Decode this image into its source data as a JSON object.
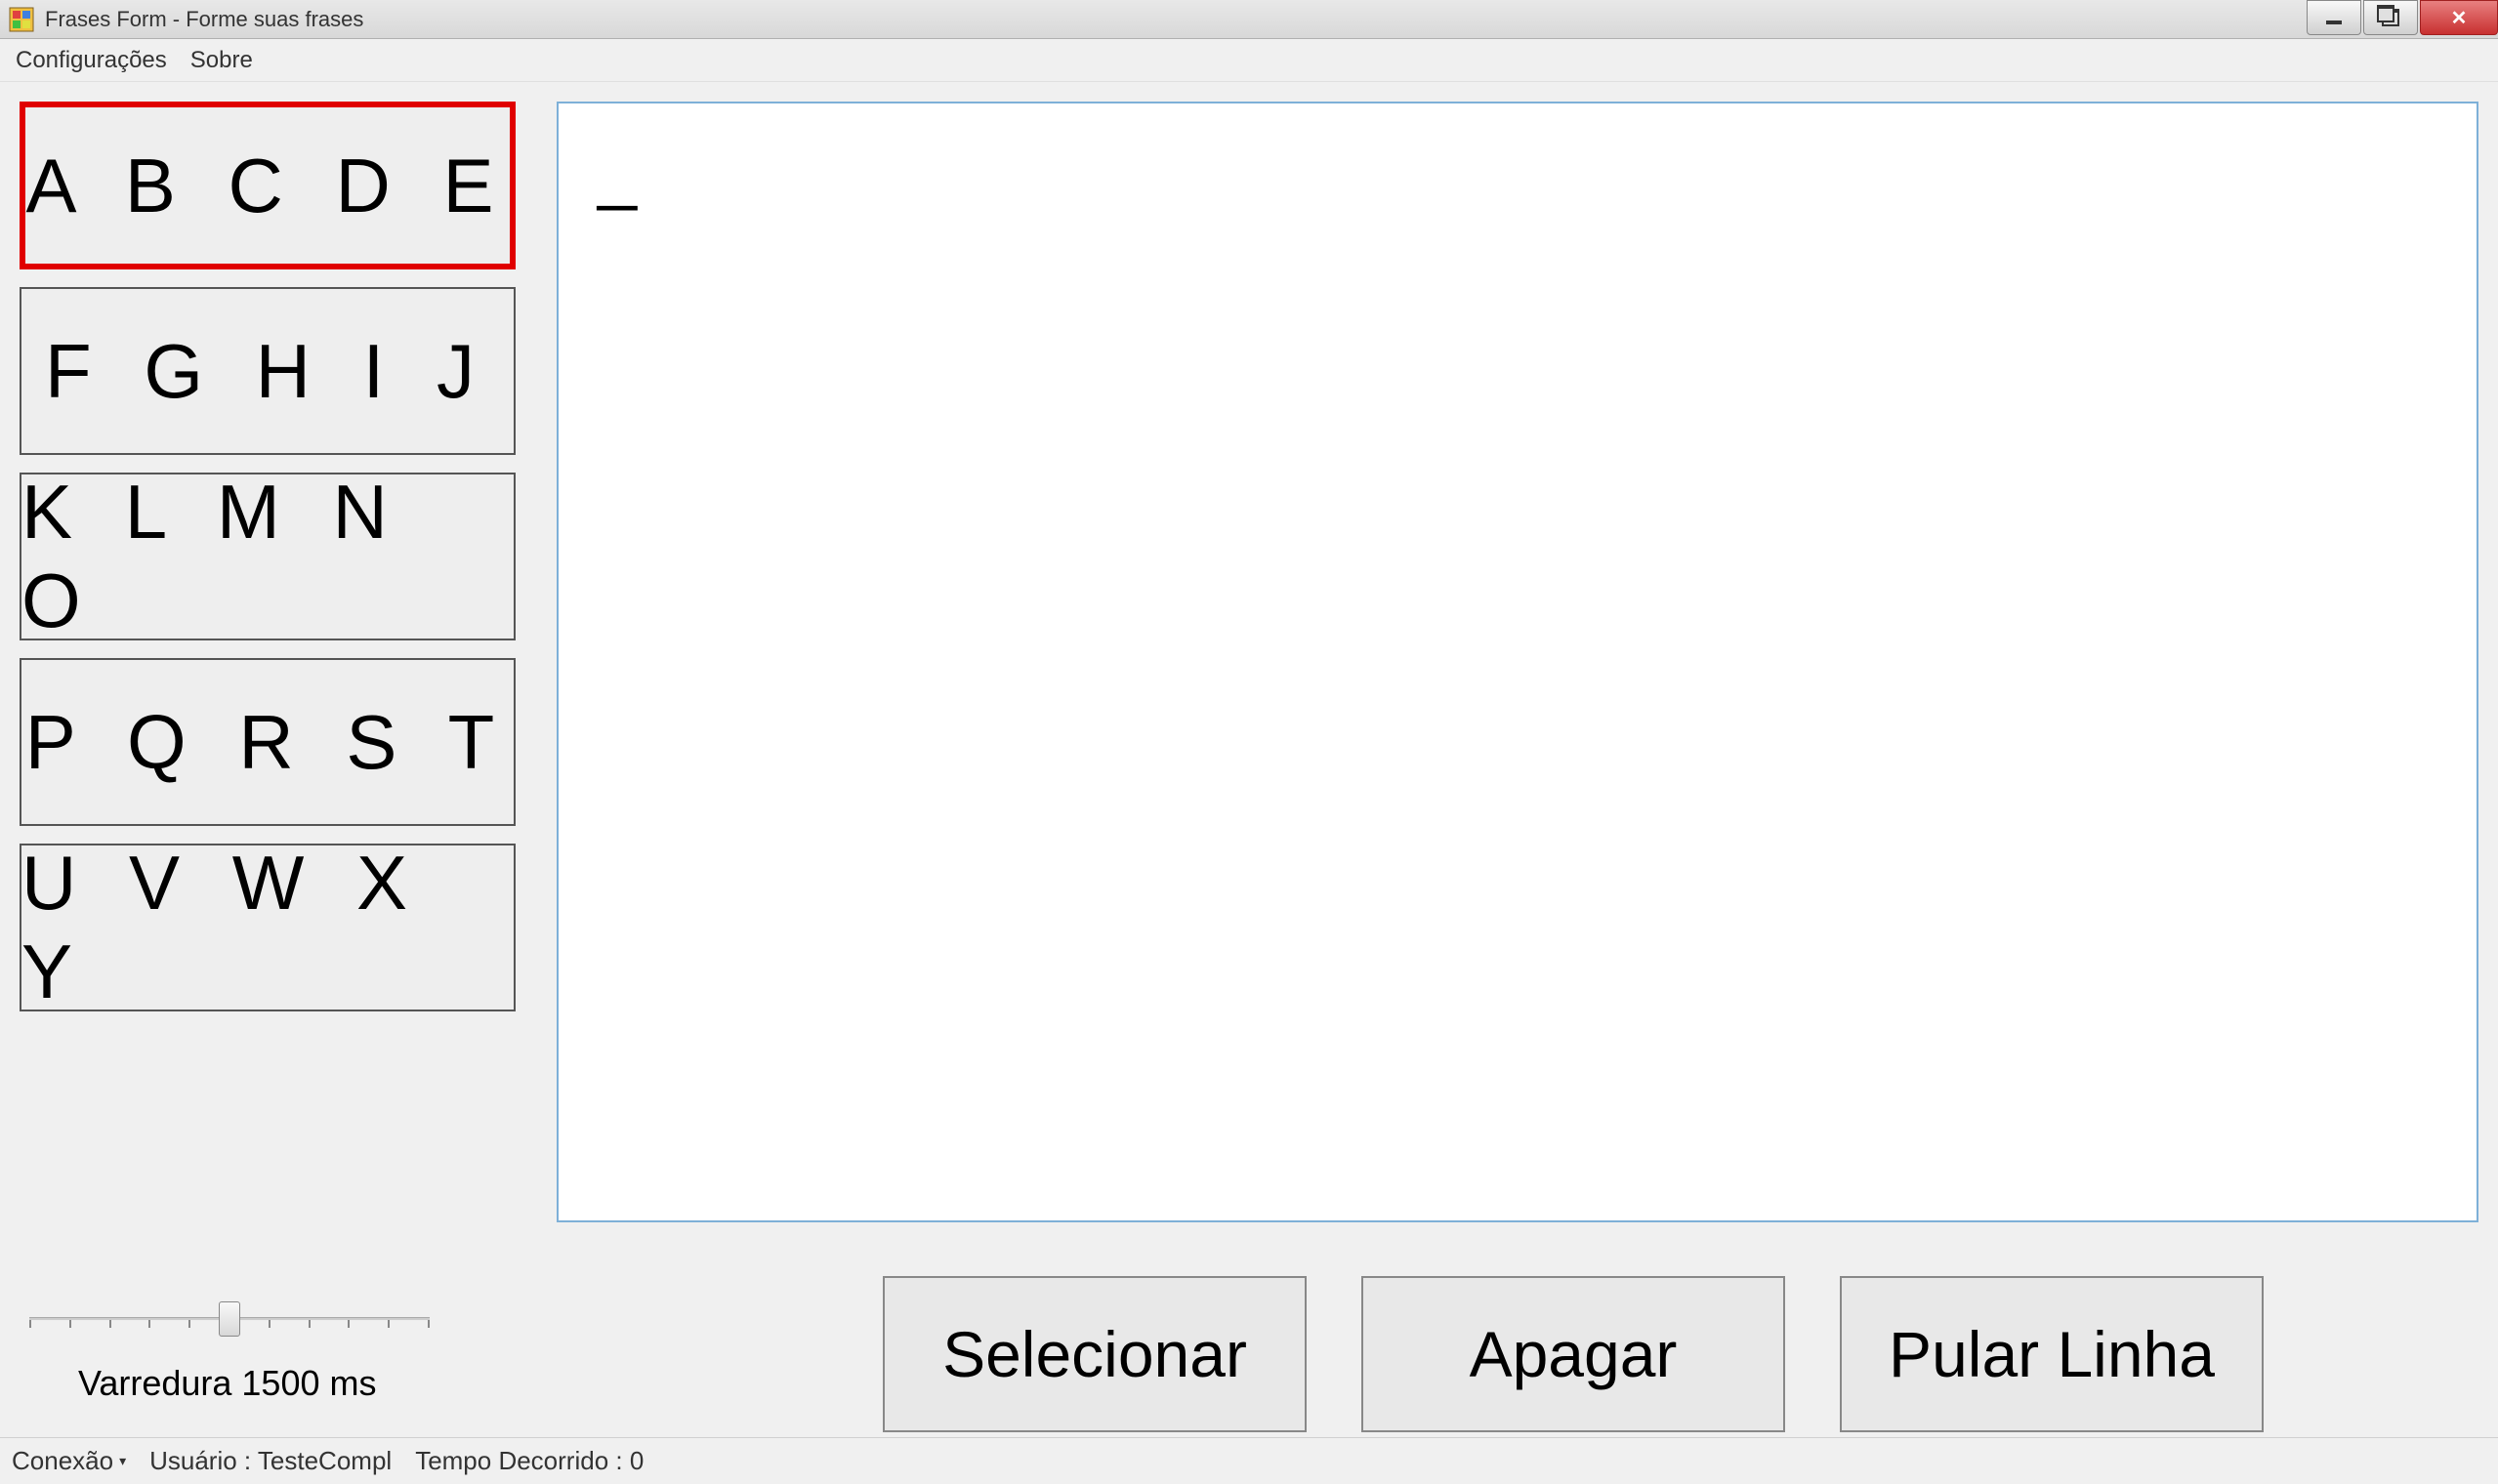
{
  "window": {
    "title": "Frases Form - Forme suas frases"
  },
  "menubar": {
    "items": [
      {
        "label": "Configurações"
      },
      {
        "label": "Sobre"
      }
    ]
  },
  "letterGroups": [
    {
      "label": "A B C D E",
      "selected": true
    },
    {
      "label": "F G H I J",
      "selected": false
    },
    {
      "label": "K L M N O",
      "selected": false
    },
    {
      "label": "P Q R S T",
      "selected": false
    },
    {
      "label": "U V W X Y",
      "selected": false
    }
  ],
  "textContent": "_",
  "slider": {
    "label": "Varredura 1500 ms",
    "position": 50,
    "ticks": 11
  },
  "actionButtons": [
    {
      "label": "Selecionar"
    },
    {
      "label": "Apagar"
    },
    {
      "label": "Pular Linha"
    }
  ],
  "statusbar": {
    "connection": "Conexão",
    "user": "Usuário : TesteCompl",
    "elapsed": "Tempo Decorrido : 0"
  }
}
